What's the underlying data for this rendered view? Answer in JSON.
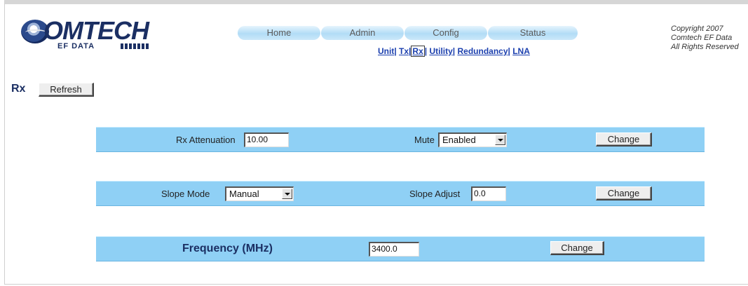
{
  "logo": {
    "brand": "OMTECH",
    "sub": "EF DATA"
  },
  "nav": {
    "tabs": [
      "Home",
      "Admin",
      "Config",
      "Status"
    ],
    "sublinks": [
      "Unit",
      "Tx",
      "Rx",
      "Utility",
      "Redundancy",
      "LNA"
    ],
    "separator": "|"
  },
  "copyright": [
    "Copyright 2007",
    "Comtech EF Data",
    "All Rights Reserved"
  ],
  "page": {
    "title": "Rx",
    "refresh_label": "Refresh"
  },
  "row1": {
    "attenuation_label": "Rx Attenuation",
    "attenuation_value": "10.00",
    "mute_label": "Mute",
    "mute_value": "Enabled",
    "change_label": "Change"
  },
  "row2": {
    "slope_mode_label": "Slope Mode",
    "slope_mode_value": "Manual",
    "slope_adjust_label": "Slope Adjust",
    "slope_adjust_value": "0.0",
    "change_label": "Change"
  },
  "row3": {
    "frequency_label": "Frequency (MHz)",
    "frequency_value": "3400.0",
    "change_label": "Change"
  },
  "colors": {
    "bar": "#8fd0f5",
    "link": "#1b3fae",
    "brand": "#1b2f63"
  }
}
